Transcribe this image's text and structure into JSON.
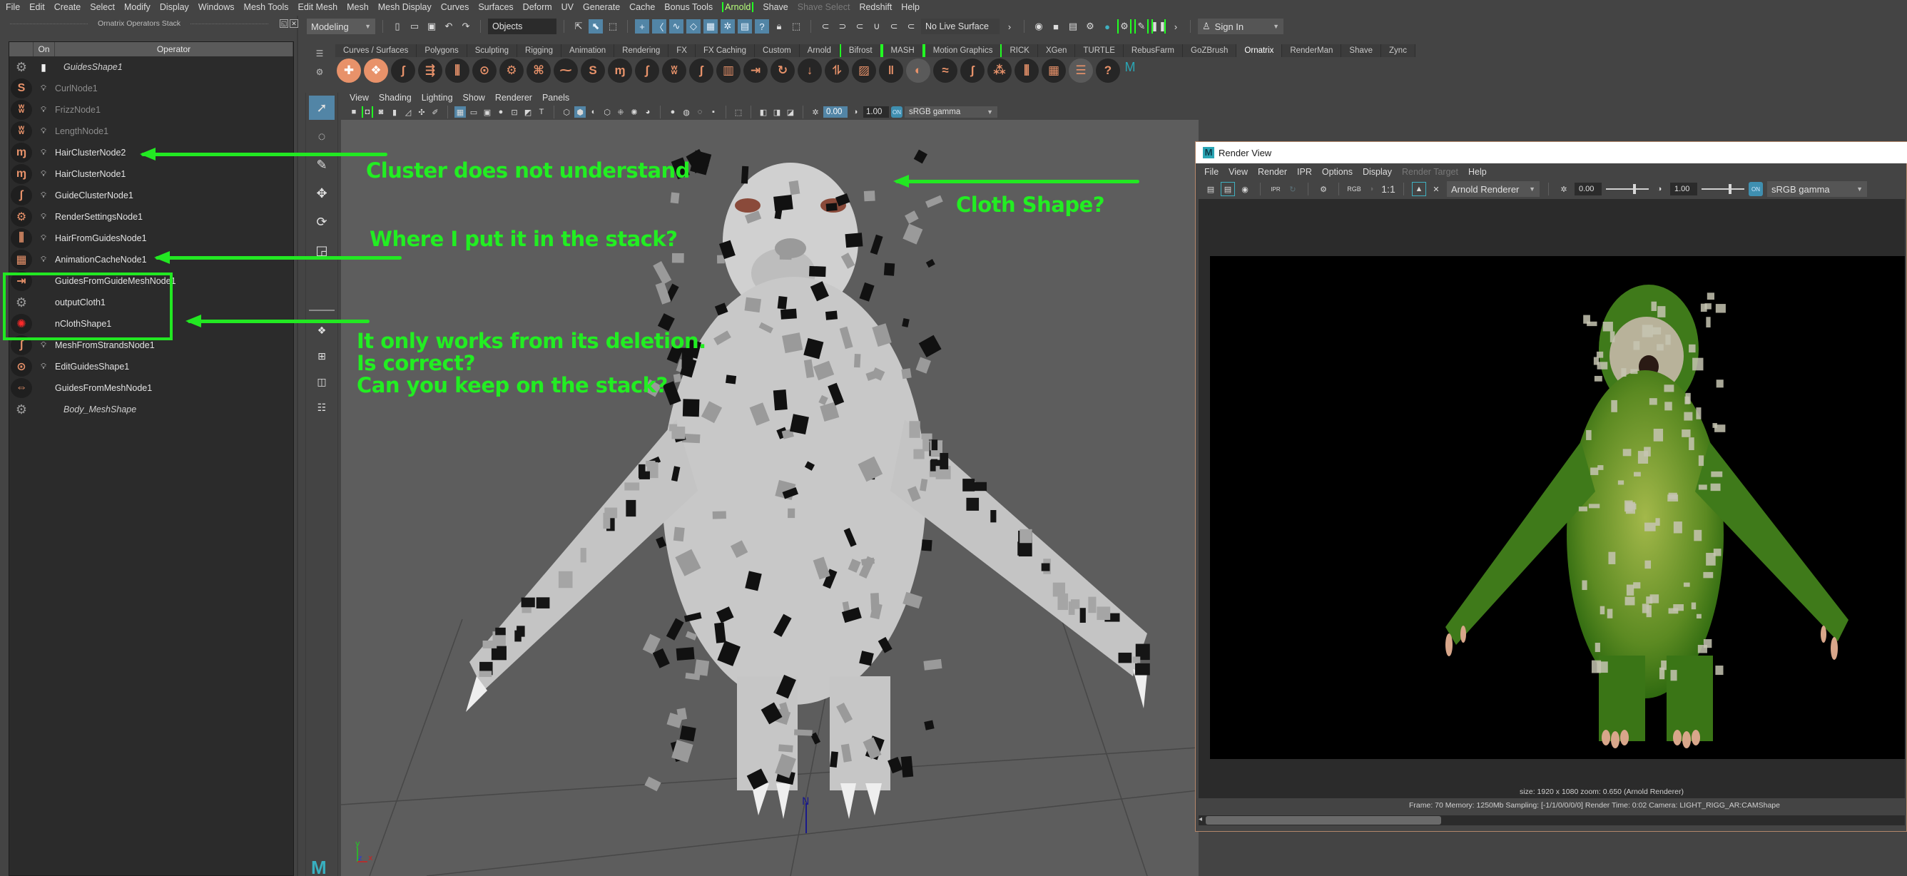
{
  "menubar": {
    "items": [
      "File",
      "Edit",
      "Create",
      "Select",
      "Modify",
      "Display",
      "Windows",
      "Mesh Tools",
      "Edit Mesh",
      "Mesh",
      "Mesh Display",
      "Curves",
      "Surfaces",
      "Deform",
      "UV",
      "Generate",
      "Cache",
      "Bonus Tools",
      "Arnold",
      "Shave",
      "Shave Select",
      "Redshift",
      "Help"
    ]
  },
  "toolbar": {
    "workspace": "Modeling",
    "selection_mode": "Objects",
    "live_surface": "No Live Surface",
    "sign_in": "Sign In"
  },
  "operators_panel": {
    "title": "Ornatrix Operators Stack",
    "columns": [
      "",
      "On",
      "Operator"
    ],
    "rows": [
      {
        "icon": "gear-icon",
        "on": "I",
        "name": "GuidesShape1",
        "style": "italic"
      },
      {
        "icon": "curl-icon",
        "on": "bulb",
        "name": "CurlNode1",
        "style": "dim"
      },
      {
        "icon": "frizz-icon",
        "on": "bulb",
        "name": "FrizzNode1",
        "style": "dim"
      },
      {
        "icon": "length-icon",
        "on": "bulb",
        "name": "LengthNode1",
        "style": "dim"
      },
      {
        "icon": "hair-cluster-icon",
        "on": "bulb",
        "name": "HairClusterNode2",
        "style": "normal"
      },
      {
        "icon": "hair-cluster-icon",
        "on": "bulb",
        "name": "HairClusterNode1",
        "style": "normal"
      },
      {
        "icon": "guide-cluster-icon",
        "on": "bulb",
        "name": "GuideClusterNode1",
        "style": "normal"
      },
      {
        "icon": "render-settings-icon",
        "on": "bulb",
        "name": "RenderSettingsNode1",
        "style": "normal"
      },
      {
        "icon": "hair-from-guides-icon",
        "on": "bulb",
        "name": "HairFromGuidesNode1",
        "style": "normal"
      },
      {
        "icon": "animation-cache-icon",
        "on": "bulb",
        "name": "AnimationCacheNode1",
        "style": "normal"
      },
      {
        "icon": "guides-from-guide-mesh-icon",
        "on": "",
        "name": "GuidesFromGuideMeshNode1",
        "style": "normal"
      },
      {
        "icon": "gear-icon",
        "on": "",
        "name": "outputCloth1",
        "style": "normal"
      },
      {
        "icon": "ncloth-icon",
        "on": "",
        "name": "nClothShape1",
        "style": "normal"
      },
      {
        "icon": "mesh-from-strands-icon",
        "on": "bulb",
        "name": "MeshFromStrandsNode1",
        "style": "normal"
      },
      {
        "icon": "edit-guides-icon",
        "on": "bulb",
        "name": "EditGuidesShape1",
        "style": "normal"
      },
      {
        "icon": "guides-from-mesh-icon",
        "on": "",
        "name": "GuidesFromMeshNode1",
        "style": "normal"
      },
      {
        "icon": "gear-icon",
        "on": "",
        "name": "Body_MeshShape",
        "style": "italic"
      }
    ]
  },
  "shelf": {
    "tabs": [
      "Curves / Surfaces",
      "Polygons",
      "Sculpting",
      "Rigging",
      "Animation",
      "Rendering",
      "FX",
      "FX Caching",
      "Custom",
      "Arnold",
      "Bifrost",
      "MASH",
      "Motion Graphics",
      "RICK",
      "XGen",
      "TURTLE",
      "RebusFarm",
      "GoZBrush",
      "Ornatrix",
      "RenderMan",
      "Shave",
      "Zync"
    ],
    "active_tab": "Ornatrix",
    "bracketed_tabs": [
      "Bifrost",
      "MASH",
      "Motion Graphics"
    ]
  },
  "viewport": {
    "menu": [
      "View",
      "Shading",
      "Lighting",
      "Show",
      "Renderer",
      "Panels"
    ],
    "exposure": "0.00",
    "gamma": "1.00",
    "color_space": "sRGB gamma",
    "axis_labels": {
      "y": "y",
      "z": "z",
      "x": "x"
    }
  },
  "annotations": {
    "cluster": "Cluster does not understand",
    "where": "Where I put it in the stack?",
    "deletion": [
      "It only works from its deletion.",
      "Is correct?",
      "Can you keep on the stack?"
    ],
    "cloth": "Cloth Shape?",
    "color": "#22ee22"
  },
  "render_view": {
    "title": "Render View",
    "menu": [
      "File",
      "View",
      "Render",
      "IPR",
      "Options",
      "Display",
      "Render Target",
      "Help"
    ],
    "disabled_menu": [
      "Render Target"
    ],
    "toolbar": {
      "rgb": "RGB",
      "ratio": "1:1",
      "renderer": "Arnold Renderer",
      "exposure": "0.00",
      "gamma": "1.00",
      "color_space": "sRGB gamma",
      "on_label": "ON",
      "ipr_label": "IPR"
    },
    "status_line1": "size: 1920 x 1080 zoom: 0.650     (Arnold Renderer)",
    "status_line2": "Frame: 70    Memory: 1250Mb    Sampling: [-1/1/0/0/0/0]    Render Time: 0:02    Camera: LIGHT_RIGG_AR:CAMShape"
  },
  "colors": {
    "accent_blue": "#5285a6",
    "annotation_green": "#22ee22",
    "ornatrix_orange": "#e8926a"
  }
}
